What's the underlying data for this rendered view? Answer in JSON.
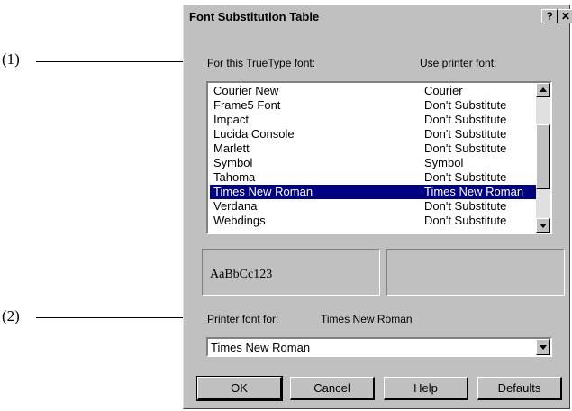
{
  "callouts": {
    "c1": "(1)",
    "c2": "(2)"
  },
  "dialog": {
    "title": "Font Substitution Table",
    "help_button": "?",
    "close_button": "✕"
  },
  "headers": {
    "truetype_prefix": "For this ",
    "truetype_mnemonic": "T",
    "truetype_suffix": "rueType font:",
    "printer": "Use printer font:"
  },
  "font_list": {
    "rows": [
      {
        "font": "Courier New",
        "printer": "Courier"
      },
      {
        "font": "Frame5 Font",
        "printer": "Don't Substitute"
      },
      {
        "font": "Impact",
        "printer": "Don't Substitute"
      },
      {
        "font": "Lucida Console",
        "printer": "Don't Substitute"
      },
      {
        "font": "Marlett",
        "printer": "Don't Substitute"
      },
      {
        "font": "Symbol",
        "printer": "Symbol"
      },
      {
        "font": "Tahoma",
        "printer": "Don't Substitute"
      },
      {
        "font": "Times New Roman",
        "printer": "Times New Roman"
      },
      {
        "font": "Verdana",
        "printer": "Don't Substitute"
      },
      {
        "font": "Webdings",
        "printer": "Don't Substitute"
      }
    ],
    "selected_font": "Times New Roman"
  },
  "preview": {
    "sample": "AaBbCc123"
  },
  "printer_font_for": {
    "mnemonic": "P",
    "label_rest": "rinter font for:",
    "font_name": "Times New Roman"
  },
  "combo": {
    "value": "Times New Roman"
  },
  "buttons": {
    "ok": "OK",
    "cancel": "Cancel",
    "help": "Help",
    "defaults": "Defaults"
  },
  "colors": {
    "dialog_face": "#c0c0c0",
    "selection": "#000080"
  },
  "icons": {
    "scroll_up": "arrow-up-icon",
    "scroll_down": "arrow-down-icon",
    "combo_dropdown": "chevron-down-icon"
  }
}
